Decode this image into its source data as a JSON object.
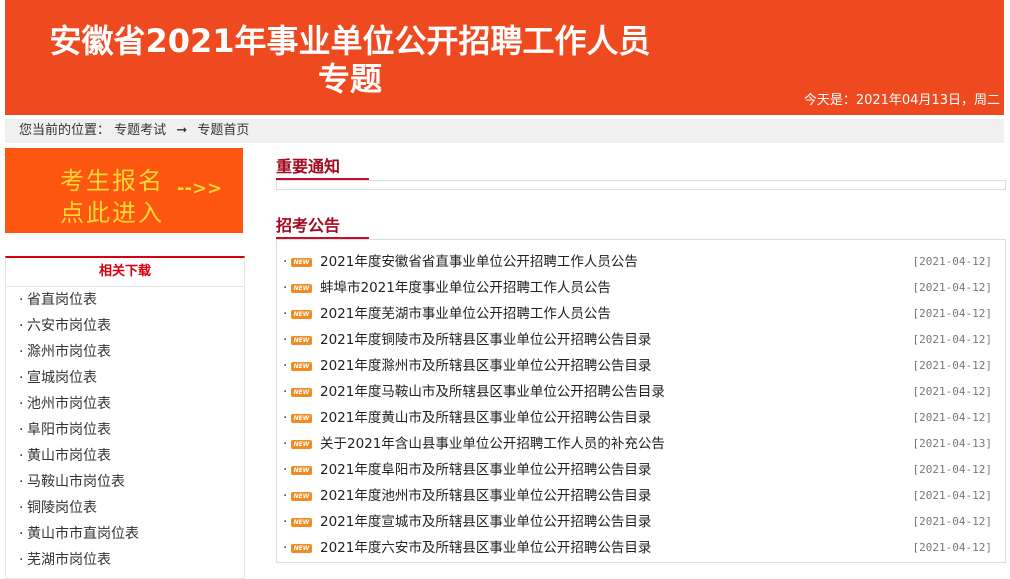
{
  "banner": {
    "title_line1": "安徽省2021年事业单位公开招聘工作人员",
    "title_line2": "专题",
    "date_text": "今天是：2021年04月13日，周二"
  },
  "breadcrumb": {
    "lead": "您当前的位置：",
    "items": [
      "专题考试",
      "专题首页"
    ],
    "separator": "➞"
  },
  "register": {
    "line1": "考生报名",
    "line2": "点此进入",
    "arrow": "-->>"
  },
  "downloads": {
    "title": "相关下载",
    "items": [
      "省直岗位表",
      "六安市岗位表",
      "滁州市岗位表",
      "宣城岗位表",
      "池州市岗位表",
      "阜阳市岗位表",
      "黄山市岗位表",
      "马鞍山市岗位表",
      "铜陵岗位表",
      "黄山市市直岗位表",
      "芜湖市岗位表"
    ]
  },
  "notices": {
    "title": "重要通知"
  },
  "announcements": {
    "title": "招考公告",
    "badge": "NEW",
    "items": [
      {
        "title": "2021年度安徽省省直事业单位公开招聘工作人员公告",
        "date": "[2021-04-12]"
      },
      {
        "title": "蚌埠市2021年度事业单位公开招聘工作人员公告",
        "date": "[2021-04-12]"
      },
      {
        "title": "2021年度芜湖市事业单位公开招聘工作人员公告",
        "date": "[2021-04-12]"
      },
      {
        "title": "2021年度铜陵市及所辖县区事业单位公开招聘公告目录",
        "date": "[2021-04-12]"
      },
      {
        "title": "2021年度滁州市及所辖县区事业单位公开招聘公告目录",
        "date": "[2021-04-12]"
      },
      {
        "title": "2021年度马鞍山市及所辖县区事业单位公开招聘公告目录",
        "date": "[2021-04-12]"
      },
      {
        "title": "2021年度黄山市及所辖县区事业单位公开招聘公告目录",
        "date": "[2021-04-12]"
      },
      {
        "title": "关于2021年含山县事业单位公开招聘工作人员的补充公告",
        "date": "[2021-04-13]"
      },
      {
        "title": "2021年度阜阳市及所辖县区事业单位公开招聘公告目录",
        "date": "[2021-04-12]"
      },
      {
        "title": "2021年度池州市及所辖县区事业单位公开招聘公告目录",
        "date": "[2021-04-12]"
      },
      {
        "title": "2021年度宣城市及所辖县区事业单位公开招聘公告目录",
        "date": "[2021-04-12]"
      },
      {
        "title": "2021年度六安市及所辖县区事业单位公开招聘公告目录",
        "date": "[2021-04-12]"
      }
    ]
  },
  "colors": {
    "banner": "#ef4a1f",
    "accent_red": "#c70e2b",
    "register_bg": "#fc5611",
    "register_text": "#ffd633",
    "new_badge": "#f58a1f"
  }
}
